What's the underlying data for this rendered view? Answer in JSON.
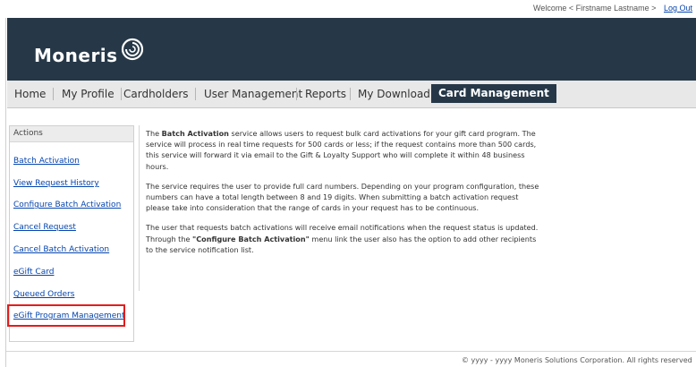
{
  "topbar": {
    "welcome": "Welcome < Firstname Lastname >",
    "logout": "Log Out"
  },
  "header": {
    "logo_text": "Moneris"
  },
  "nav": {
    "items": [
      "Home",
      "My Profile",
      "Cardholders",
      "User Management",
      "Reports",
      "My Download",
      "Card Management"
    ],
    "active": "Card Management"
  },
  "sidebar": {
    "title": "Actions",
    "items": [
      "Batch Activation",
      "View Request History",
      "Configure Batch Activation",
      "Cancel Request",
      "Cancel Batch Activation",
      "eGift Card",
      "Queued Orders",
      "eGift Program Management"
    ],
    "highlighted": "eGift Program Management"
  },
  "content": {
    "p1_pre": "The ",
    "p1_bold": "Batch Activation",
    "p1_post": " service allows users to request bulk card activations for your gift card program. The service will process in real time requests for 500 cards or less; if the request contains more than 500 cards, this service will forward it via email to the Gift & Loyalty Support who will complete it within 48 business hours.",
    "p2": "The service requires the user to provide full card numbers. Depending on your program configuration, these numbers can have a total length between 8 and 19 digits. When submitting a batch activation request please take into consideration that the range of cards in your request has to be continuous.",
    "p3_pre": "The user that requests batch activations will receive email notifications when the request status is updated. Through the ",
    "p3_bold": "\"Configure Batch Activation\"",
    "p3_post": " menu link the user also has the option to add other recipients to the service notification list."
  },
  "footer": {
    "copyright": "© yyyy - yyyy  Moneris Solutions Corporation. All rights reserved"
  },
  "colors": {
    "header_bg": "#263848",
    "highlight": "#e31c1c",
    "link": "#0645ad"
  }
}
